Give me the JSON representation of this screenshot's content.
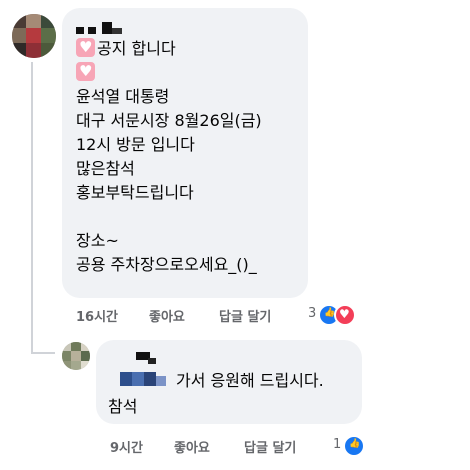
{
  "comment": {
    "lines": [
      "공지 합니다",
      "",
      "윤석열 대통령",
      "대구 서문시장 8월26일(금)",
      "12시 방문 입니다",
      "많은참석",
      "홍보부탁드립니다",
      "",
      "장소~",
      "공용 주차장으로오세요_()_"
    ],
    "time": "16시간",
    "like_label": "좋아요",
    "reply_label": "답글 달기",
    "reaction_count": "3",
    "reactions": [
      "like-icon",
      "love-icon"
    ]
  },
  "reply": {
    "lines": [
      "가서 응원해 드립시다.",
      "참석"
    ],
    "time": "9시간",
    "like_label": "좋아요",
    "reply_label": "답글 달기",
    "reaction_count": "1",
    "reactions": [
      "like-icon"
    ]
  },
  "colors": {
    "bubble": "#f0f2f5",
    "meta_text": "#65676b",
    "like_blue": "#1877f2",
    "love_red": "#f33e58",
    "heart_emoji_bg": "#f7a5b6"
  }
}
